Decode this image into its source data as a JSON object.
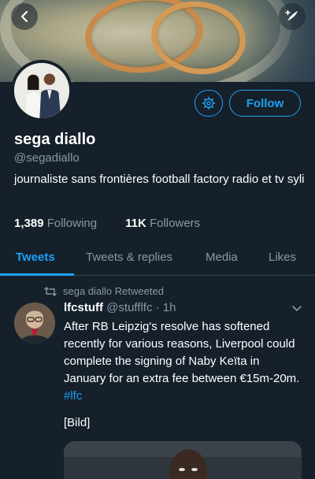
{
  "profile": {
    "name": "sega diallo",
    "handle": "@segadiallo",
    "bio": "journaliste sans frontières football factory radio et tv syli",
    "following_count": "1,389",
    "following_label": "Following",
    "followers_count": "11K",
    "followers_label": "Followers",
    "follow_label": "Follow"
  },
  "tabs": [
    {
      "label": "Tweets",
      "active": true
    },
    {
      "label": "Tweets & replies",
      "active": false
    },
    {
      "label": "Media",
      "active": false
    },
    {
      "label": "Likes",
      "active": false
    }
  ],
  "tweet": {
    "retweet_note": "sega diallo Retweeted",
    "author_name": "lfcstuff",
    "author_meta": "@stufflfc · 1h",
    "text": "After RB Leipzig's resolve has softened recently for various reasons, Liverpool could complete the signing of Naby Keïta in January for an extra fee between €15m-20m.",
    "hashtag": "#lfc",
    "media_label": "[Bild]"
  },
  "colors": {
    "background": "#15202b",
    "accent": "#1da1f2",
    "muted": "#8899a6"
  },
  "icons": [
    "back-arrow-icon",
    "compose-icon",
    "gear-icon",
    "retweet-icon",
    "chevron-down-icon"
  ]
}
